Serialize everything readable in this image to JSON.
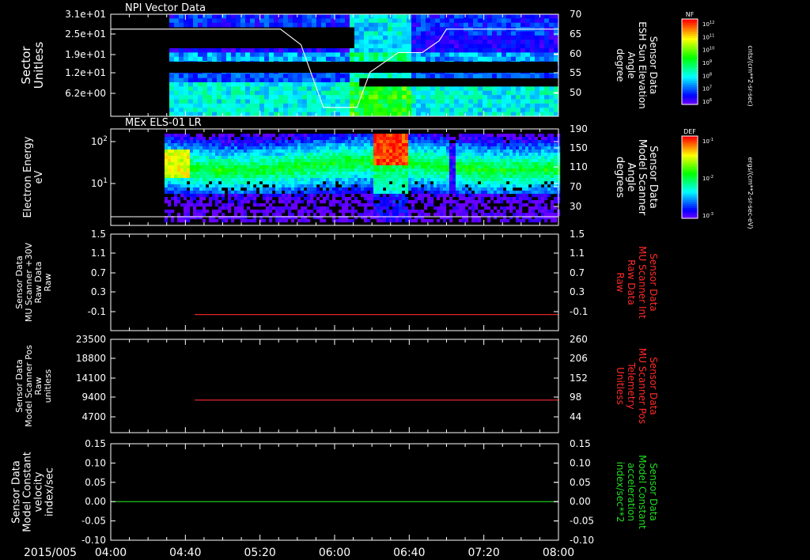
{
  "date_label": "2015/005",
  "time_ticks": [
    "04:00",
    "04:40",
    "05:20",
    "06:00",
    "06:40",
    "07:20",
    "08:00"
  ],
  "colors": {
    "axis": "#ffffff",
    "red": "#ff2a2a",
    "green": "#22dd22",
    "background": "#000000"
  },
  "chart_data": [
    {
      "type": "heatmap",
      "title": "NPI Vector Data",
      "ylabel": [
        "Sector",
        "Unitless"
      ],
      "y_ticks": [
        "3.1e+01",
        "2.5e+01",
        "1.9e+01",
        "1.2e+01",
        "6.2e+00"
      ],
      "y2label": [
        "Sensor Data",
        "ESH Sun Elevation",
        "Angle",
        "degree"
      ],
      "y2_ticks": [
        "70",
        "65",
        "60",
        "55",
        "50"
      ],
      "y2_range": [
        45,
        70
      ],
      "overlay_line": {
        "x": [
          "04:00",
          "04:35",
          "05:31",
          "05:42",
          "05:54",
          "06:12",
          "06:19",
          "06:34",
          "06:47",
          "06:56",
          "07:00",
          "08:00"
        ],
        "y": [
          66,
          66,
          66,
          62,
          46,
          46,
          55,
          60,
          60,
          63,
          66,
          66
        ]
      },
      "colorbar": {
        "label": "NF",
        "units": "cnts/(cm**2-sr-sec)",
        "ticks": [
          "10^12",
          "10^11",
          "10^10",
          "10^9",
          "10^8",
          "10^7",
          "10^6"
        ]
      }
    },
    {
      "type": "heatmap",
      "title": "MEx ELS-01 LR",
      "ylabel": [
        "Electron Energy",
        "eV"
      ],
      "y_ticks": [
        "10^2",
        "10^1"
      ],
      "y2label": [
        "Sensor Data",
        "Model Scanner",
        "Angle",
        "degrees"
      ],
      "y2_ticks": [
        "190",
        "150",
        "110",
        "70",
        "30"
      ],
      "colorbar": {
        "label": "DEF",
        "units": "ergs/(cm**2-sr-sec-eV)",
        "ticks": [
          "10^-1",
          "10^-2",
          "10^-3"
        ]
      }
    },
    {
      "type": "line",
      "ylabel": [
        "Sensor Data",
        "MU Scanner +30V",
        "Raw Data",
        "Raw"
      ],
      "y_ticks": [
        "1.5",
        "1.1",
        "0.7",
        "0.3",
        "-0.1"
      ],
      "y2label": [
        "Sensor Data",
        "MU Scanner Int",
        "Raw Data",
        "Raw"
      ],
      "y2_ticks": [
        "1.5",
        "1.1",
        "0.7",
        "0.3",
        "-0.1"
      ],
      "ylim": [
        -0.3,
        1.5
      ],
      "series": [
        {
          "x": [
            "04:45",
            "08:00"
          ],
          "values": [
            0.0,
            0.0
          ],
          "color": "#ff2a2a"
        }
      ]
    },
    {
      "type": "line",
      "ylabel": [
        "Sensor Data",
        "Model Scanner Pos",
        "Raw",
        "unitless"
      ],
      "y_ticks": [
        "23500",
        "18800",
        "14100",
        "9400",
        "4700"
      ],
      "y2label": [
        "Sensor Data",
        "MU Scanner Pos",
        "Telemetry",
        "Unitless"
      ],
      "y2_ticks": [
        "260",
        "206",
        "152",
        "98",
        "44"
      ],
      "ylim": [
        0,
        23500
      ],
      "series": [
        {
          "x": [
            "04:45",
            "08:00"
          ],
          "values": [
            8200,
            8200
          ],
          "color": "#ff2a2a"
        }
      ]
    },
    {
      "type": "line",
      "ylabel": [
        "Sensor Data",
        "Model Constant",
        "velocity",
        "index/sec"
      ],
      "y_ticks": [
        "0.15",
        "0.10",
        "0.05",
        "0.00",
        "-0.05",
        "-0.10"
      ],
      "y2label": [
        "Sensor Data",
        "Model Constant",
        "acceleration",
        "index/sec**2"
      ],
      "y2_ticks": [
        "0.15",
        "0.10",
        "0.05",
        "0.00",
        "-0.05",
        "-0.10"
      ],
      "ylim": [
        -0.1,
        0.15
      ],
      "series": [
        {
          "x": [
            "04:00",
            "08:00"
          ],
          "values": [
            0.0,
            0.0
          ],
          "color": "#22dd22"
        }
      ]
    }
  ]
}
